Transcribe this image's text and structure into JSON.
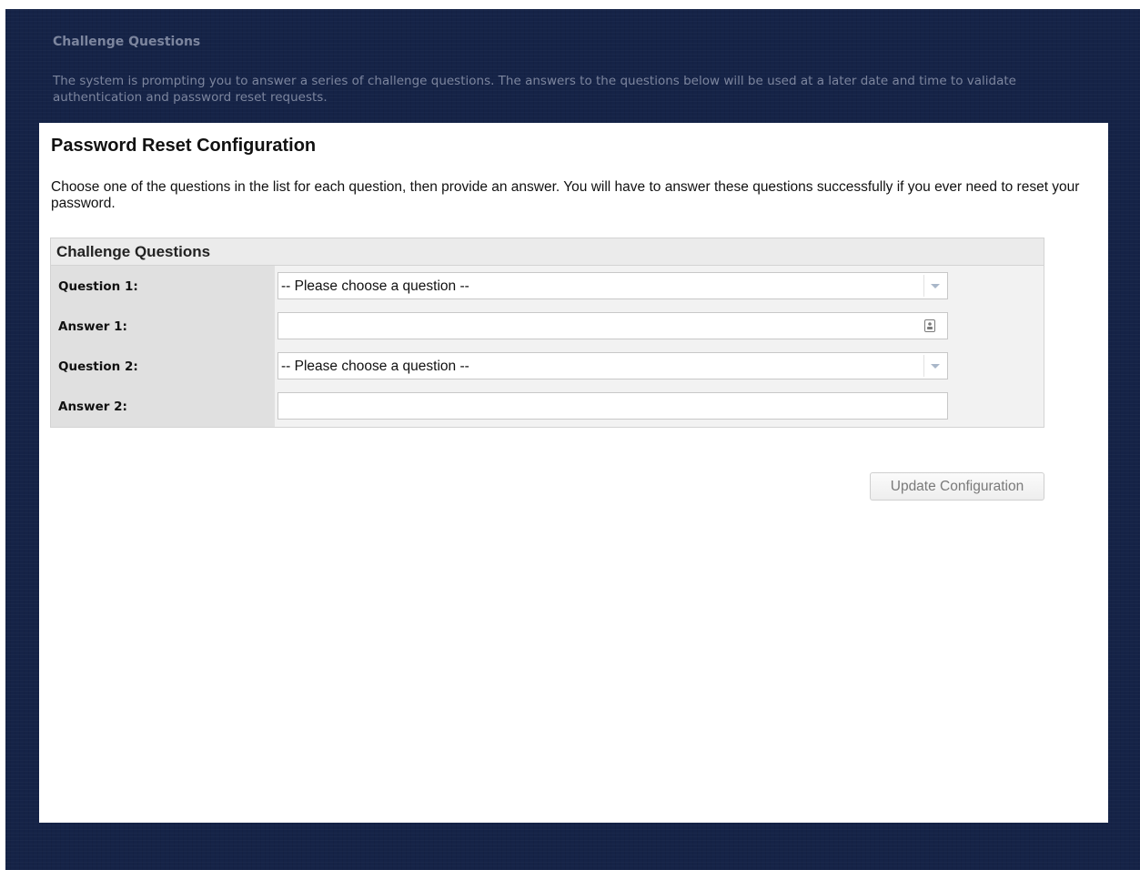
{
  "banner": {
    "title": "Challenge Questions",
    "text": "The system is prompting you to answer a series of challenge questions. The answers to the questions below will be used at a later date and time to validate authentication and password reset requests."
  },
  "panel": {
    "title": "Password Reset Configuration",
    "description": "Choose one of the questions in the list for each question, then provide an answer. You will have to answer these questions successfully if you ever need to reset your password."
  },
  "challenge": {
    "header": "Challenge Questions",
    "question1_label": "Question 1:",
    "question1_value": "-- Please choose a question --",
    "answer1_label": "Answer 1:",
    "answer1_value": "",
    "question2_label": "Question 2:",
    "question2_value": "-- Please choose a question --",
    "answer2_label": "Answer 2:",
    "answer2_value": ""
  },
  "actions": {
    "update_label": "Update Configuration"
  },
  "colors": {
    "background": "#152347",
    "banner_text": "#7c859e",
    "panel": "#ffffff"
  },
  "icons": {
    "dropdown": "chevron-down-icon",
    "answer1_field": "contact-card-icon"
  }
}
